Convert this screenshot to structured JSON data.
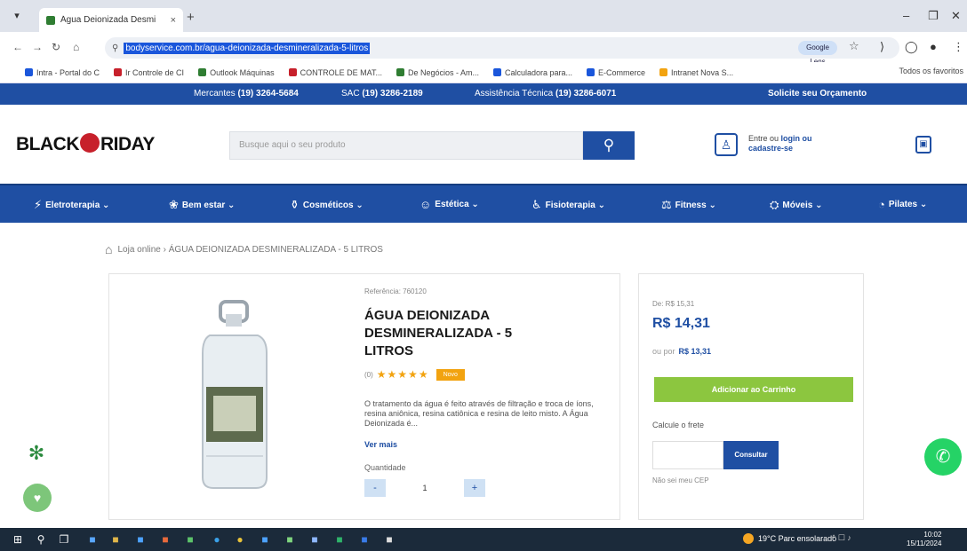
{
  "browser": {
    "tab_title": "Água Deionizada Desmi",
    "tab_close": "×",
    "new_tab": "+",
    "url": "bodyservice.com.br/agua-deionizada-desmineralizada-5-litros",
    "omni_badge": "Google Lens",
    "bookmarks": [
      {
        "label": "Intra - Portal do C",
        "color": "#1a56db"
      },
      {
        "label": "Ir Controle de CI",
        "color": "#c7202b"
      },
      {
        "label": "Outlook Máquinas",
        "color": "#2f7d32"
      },
      {
        "label": "CONTROLE DE MAT...",
        "color": "#c7202b"
      },
      {
        "label": "De Negócios - Am...",
        "color": "#2f7d32"
      },
      {
        "label": "Calculadora para...",
        "color": "#1a56db"
      },
      {
        "label": "E-Commerce",
        "color": "#1a56db"
      },
      {
        "label": "Intranet Nova S...",
        "color": "#f2a310"
      }
    ],
    "bookmarks_right": "Todos os favoritos"
  },
  "topbar": {
    "phone1_label": "Mercantes",
    "phone1": "(19) 3264-5684",
    "phone2_label": "SAC",
    "phone2": "(19) 3286-2189",
    "phone3_label": "Assistência Técnica",
    "phone3": "(19) 3286-6071",
    "quote": "Solicite seu Orçamento"
  },
  "header": {
    "logo_left": "BLACK",
    "logo_right": "RIDAY",
    "search_placeholder": "Busque aqui o seu produto",
    "login_line1": "Entre ou",
    "login_bold": "login ou",
    "login_line2": "cadastre-se"
  },
  "categories": [
    {
      "label": "Eletroterapia",
      "icon": "electrotherapy-icon"
    },
    {
      "label": "Bem estar",
      "icon": "wellness-icon"
    },
    {
      "label": "Cosméticos",
      "icon": "cosmetics-icon"
    },
    {
      "label": "Estética",
      "icon": "aesthetics-icon"
    },
    {
      "label": "Fisioterapia",
      "icon": "physio-icon"
    },
    {
      "label": "Fitness",
      "icon": "fitness-icon"
    },
    {
      "label": "Móveis",
      "icon": "furniture-icon"
    },
    {
      "label": "Pilates",
      "icon": "pilates-icon"
    }
  ],
  "breadcrumb": {
    "home": "Loja online",
    "sep": "›",
    "current": "ÁGUA DEIONIZADA DESMINERALIZADA - 5 LITROS"
  },
  "product": {
    "brand": "Referência: 760120",
    "title": "ÁGUA DEIONIZADA DESMINERALIZADA - 5 LITROS",
    "rating_prefix": "(0)",
    "stars": "★★★★★",
    "rating_value": 5,
    "badge": "Novo",
    "description": "O tratamento da água é feito através de filtração e troca de íons, resina aniônica, resina catiônica e resina de leito misto. A Água Deionizada é...",
    "see_more": "Ver mais",
    "qty_label": "Quantidade",
    "qty_minus": "-",
    "qty_value": "1",
    "qty_plus": "+"
  },
  "pricing": {
    "de_por": "De: R$ 15,31",
    "price": "R$ 14,31",
    "old_prefix": "ou por",
    "old_price": "R$ 13,31",
    "add_to_cart": "Adicionar ao Carrinho",
    "frete_label": "Calcule o frete",
    "consultar": "Consultar",
    "no_cep": "Não sei meu CEP"
  },
  "taskbar": {
    "weather": "19°C Parc ensolarado",
    "clock_time": "10:02",
    "clock_date": "15/11/2024",
    "tray": "^ ☐ ♪"
  },
  "colors": {
    "brand_blue": "#1f4fa3",
    "accent_green": "#8cc63f",
    "star_gold": "#f2a310",
    "whatsapp_green": "#25d366"
  }
}
